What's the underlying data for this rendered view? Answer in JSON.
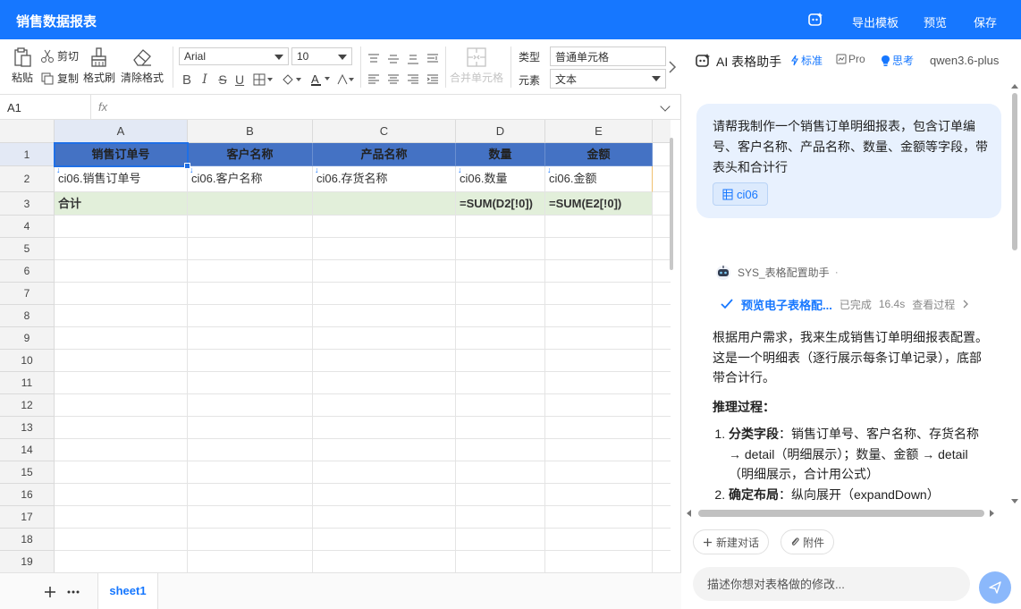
{
  "app": {
    "title": "销售数据报表",
    "actions": [
      "导出模板",
      "预览",
      "保存"
    ]
  },
  "ribbon": {
    "paste": "粘贴",
    "cut": "剪切",
    "copy": "复制",
    "format_painter": "格式刷",
    "clear_format": "清除格式",
    "font_family": "Arial",
    "font_size": "10",
    "merge_cells": "合并单元格",
    "type_label": "类型",
    "type_value": "普通单元格",
    "element_label": "元素",
    "element_value": "文本"
  },
  "formula_bar": {
    "cell_ref": "A1",
    "fx": "fx",
    "formula": ""
  },
  "sheet": {
    "columns": [
      "A",
      "B",
      "C",
      "D",
      "E"
    ],
    "rows": [
      "1",
      "2",
      "3",
      "4",
      "5",
      "6",
      "7",
      "8",
      "9",
      "10",
      "11",
      "12",
      "13",
      "14",
      "15",
      "16",
      "17",
      "18",
      "19"
    ],
    "row1": [
      "销售订单号",
      "客户名称",
      "产品名称",
      "数量",
      "金额"
    ],
    "row2": [
      "ci06.销售订单号",
      "ci06.客户名称",
      "ci06.存货名称",
      "ci06.数量",
      "ci06.金额"
    ],
    "row3": [
      "合计",
      "",
      "",
      "=SUM(D2[!0])",
      "=SUM(E2[!0])"
    ],
    "active_cell": "A1",
    "header_fill": "#4472c4",
    "total_fill": "#e2efda"
  },
  "sheet_tabs": {
    "active": "sheet1"
  },
  "assistant": {
    "title": "AI 表格助手",
    "mode_standard": "标准",
    "mode_pro": "Pro",
    "think": "思考",
    "model": "qwen3.6-plus",
    "user_message": "请帮我制作一个销售订单明细报表，包含订单编号、客户名称、产品名称、数量、金额等字段，带表头和合计行",
    "user_tag": "ci06",
    "bot_name": "SYS_表格配置助手",
    "tool_name": "预览电子表格配...",
    "tool_status": "已完成",
    "tool_time": "16.4s",
    "tool_view": "查看过程",
    "reply_intro": "根据用户需求，我来生成销售订单明细报表配置。这是一个明细表（逐行展示每条订单记录），底部带合计行。",
    "reply_heading": "推理过程：",
    "steps": [
      {
        "label": "分类字段",
        "text": "：销售订单号、客户名称、存货名称 → detail（明细展示）；数量、金额 → detail（明细展示，合计用公式）"
      },
      {
        "label": "确定布局",
        "text": "：纵向展开（expandDown）"
      }
    ],
    "new_chat": "新建对话",
    "attach": "附件",
    "input_placeholder": "描述你想对表格做的修改..."
  },
  "colors": {
    "brand": "#1677ff",
    "selection": "#1f6fe5"
  }
}
